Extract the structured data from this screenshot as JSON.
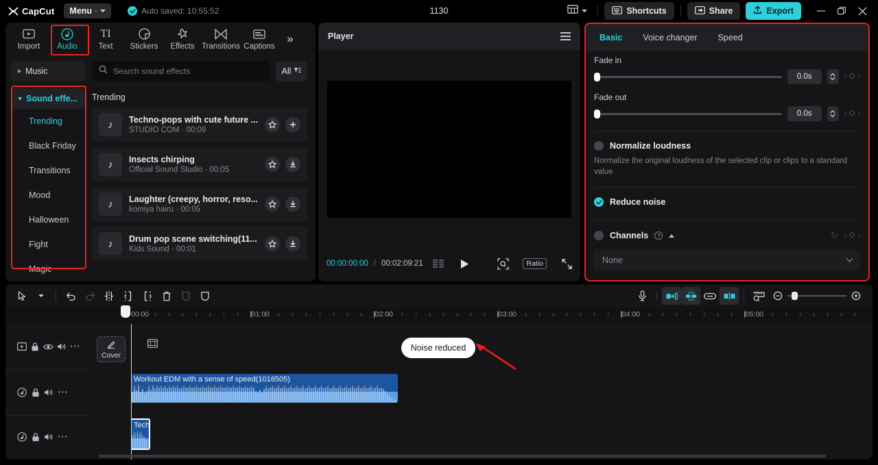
{
  "titlebar": {
    "brand": "CapCut",
    "menu_label": "Menu",
    "autosave": "Auto saved: 10:55:52",
    "project_title": "1130",
    "shortcuts_label": "Shortcuts",
    "share_label": "Share",
    "export_label": "Export",
    "accent": "#2ecfd8",
    "icons": {
      "layout": "layout-icon",
      "layout_caret": "chevron-down-icon",
      "shortcuts": "keyboard-icon",
      "share": "share-icon",
      "export": "upload-icon",
      "minimize": "minimize-icon",
      "maximize": "restore-icon",
      "close": "close-icon"
    }
  },
  "left_panel": {
    "tabs": [
      {
        "label": "Import",
        "icon": "import-icon",
        "active": false
      },
      {
        "label": "Audio",
        "icon": "music-note-icon",
        "active": true
      },
      {
        "label": "Text",
        "icon": "text-icon",
        "active": false
      },
      {
        "label": "Stickers",
        "icon": "sticker-icon",
        "active": false
      },
      {
        "label": "Effects",
        "icon": "effects-icon",
        "active": false
      },
      {
        "label": "Transitions",
        "icon": "transitions-icon",
        "active": false
      },
      {
        "label": "Captions",
        "icon": "captions-icon",
        "active": false
      }
    ],
    "tabs_more": "»",
    "categories": {
      "music_label": "Music",
      "sound_effects_label": "Sound effe...",
      "items": [
        {
          "label": "Trending",
          "active": true
        },
        {
          "label": "Black Friday",
          "active": false
        },
        {
          "label": "Transitions",
          "active": false
        },
        {
          "label": "Mood",
          "active": false
        },
        {
          "label": "Halloween",
          "active": false
        },
        {
          "label": "Fight",
          "active": false
        },
        {
          "label": "Magic",
          "active": false
        }
      ]
    },
    "search": {
      "placeholder": "Search sound effects",
      "value": ""
    },
    "filter_label": "All",
    "section_title": "Trending",
    "sounds": [
      {
        "name": "Techno-pops with cute future ...",
        "meta": "STUDIO COM · 00:09",
        "action": "add-icon"
      },
      {
        "name": "Insects chirping",
        "meta": "Official Sound Studio · 00:05",
        "action": "download-icon"
      },
      {
        "name": "Laughter (creepy, horror, reso...",
        "meta": "komiya hairu · 00:05",
        "action": "download-icon"
      },
      {
        "name": "Drum pop scene switching(11...",
        "meta": "Kids Sound · 00:01",
        "action": "download-icon"
      }
    ]
  },
  "player": {
    "title": "Player",
    "current_time": "00:00:00:00",
    "separator": "/",
    "total_time": "00:02:09:21",
    "ratio_label": "Ratio",
    "icons": {
      "menu": "hamburger-icon",
      "frames": "frames-icon",
      "play": "play-icon",
      "magnify": "magnifier-icon",
      "fullscreen": "fullscreen-icon"
    }
  },
  "right_panel": {
    "tabs": [
      {
        "label": "Basic",
        "active": true
      },
      {
        "label": "Voice changer",
        "active": false
      },
      {
        "label": "Speed",
        "active": false
      }
    ],
    "fade_in": {
      "label": "Fade in",
      "value": "0.0s"
    },
    "fade_out": {
      "label": "Fade out",
      "value": "0.0s"
    },
    "normalize": {
      "label": "Normalize loudness",
      "checked": false,
      "description": "Normalize the original loudness of the selected clip or clips to a standard value"
    },
    "reduce_noise": {
      "label": "Reduce noise",
      "checked": true
    },
    "channels": {
      "label": "Channels",
      "checked": false,
      "selected": "None"
    }
  },
  "timeline": {
    "tools": [
      {
        "name": "select-tool",
        "active": false
      },
      {
        "name": "tool-dropdown-caret",
        "active": false
      },
      {
        "name": "undo-tool",
        "active": false
      },
      {
        "name": "redo-tool",
        "active": false,
        "dim": true
      },
      {
        "name": "split-tool",
        "active": false
      },
      {
        "name": "trim-left-tool",
        "active": false
      },
      {
        "name": "trim-right-tool",
        "active": false
      },
      {
        "name": "delete-tool",
        "active": false
      },
      {
        "name": "freeze-tool",
        "active": false,
        "dim": true
      },
      {
        "name": "mask-tool",
        "active": false
      }
    ],
    "right_tools": [
      {
        "name": "record-audio-tool",
        "active": false
      },
      {
        "name": "auto-cut-tool",
        "active": true
      },
      {
        "name": "auto-captions-tool",
        "active": true
      },
      {
        "name": "link-tool",
        "active": false
      },
      {
        "name": "mirror-tool",
        "active": true
      },
      {
        "name": "ruler-tool",
        "active": false
      },
      {
        "name": "zoom-out-tool",
        "active": false
      },
      {
        "name": "zoom-in-tool",
        "active": false
      }
    ],
    "ruler_labels": [
      "00:00",
      "|01:00",
      "|02:00",
      "|03:00",
      "|04:00",
      "|05:00"
    ],
    "cover_label": "Cover",
    "track_controls": [
      {
        "icons": [
          "video-preview-icon",
          "lock-icon",
          "eye-icon",
          "volume-icon",
          "more-icon"
        ]
      },
      {
        "icons": [
          "audio-wave-icon",
          "lock-icon",
          "volume-icon",
          "more-icon"
        ]
      },
      {
        "icons": [
          "audio-wave-icon",
          "lock-icon",
          "volume-icon",
          "more-icon"
        ]
      }
    ],
    "clips": [
      {
        "name": "Workout EDM with a sense of speed(1016505)",
        "selected": false
      },
      {
        "name": "Tech",
        "selected": true
      }
    ],
    "annotation": {
      "badge": "Noise reduced",
      "arrow_color": "#ee1c1c"
    },
    "playhead_time": "00:00"
  }
}
